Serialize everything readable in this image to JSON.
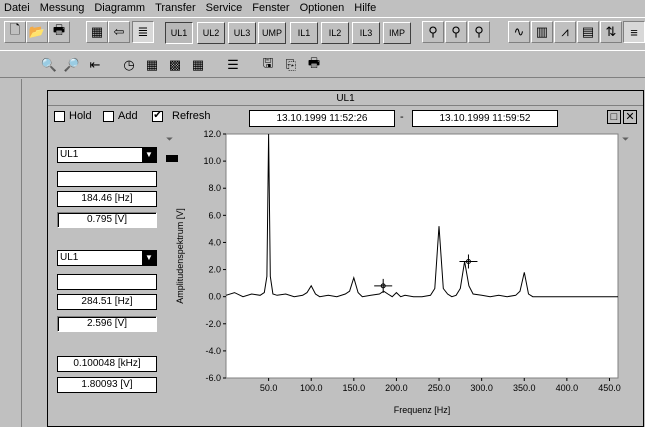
{
  "menu": [
    "Datei",
    "Messung",
    "Diagramm",
    "Transfer",
    "Service",
    "Fenster",
    "Optionen",
    "Hilfe"
  ],
  "channel_buttons": [
    "UL1",
    "UL2",
    "UL3",
    "UMP",
    "IL1",
    "IL2",
    "IL3",
    "IMP"
  ],
  "window": {
    "title": "UL1",
    "hold_label": "Hold",
    "add_label": "Add",
    "refresh_label": "Refresh",
    "refresh_checked": "✔",
    "date_from": "13.10.1999     11:52:26",
    "date_sep": "-",
    "date_to": "13.10.1999     11:59:52",
    "restore_label": "□",
    "close_label": "✕"
  },
  "cursor1": {
    "channel": "UL1",
    "name": "",
    "freq": "184.46 [Hz]",
    "value": "0.795 [V]"
  },
  "cursor2": {
    "channel": "UL1",
    "name": "",
    "freq": "284.51 [Hz]",
    "value": "2.596 [V]"
  },
  "delta": {
    "freq": "0.100048 [kHz]",
    "value": "1.80093 [V]"
  },
  "chart_data": {
    "type": "line",
    "xlabel": "Frequenz [Hz]",
    "ylabel": "Amplitudenspektrum [V]",
    "xlim": [
      0,
      460
    ],
    "ylim": [
      -6.0,
      12.0
    ],
    "x_ticks": [
      "50.0",
      "100.0",
      "150.0",
      "200.0",
      "250.0",
      "300.0",
      "350.0",
      "400.0",
      "450.0"
    ],
    "y_ticks": [
      "12.0",
      "10.0",
      "8.0",
      "6.0",
      "4.0",
      "2.0",
      "0.0",
      "-2.0",
      "-4.0",
      "-6.0"
    ],
    "series": [
      {
        "color": "#000000",
        "x": [
          0,
          10,
          20,
          30,
          40,
          45,
          48,
          50,
          52,
          55,
          60,
          70,
          80,
          90,
          95,
          100,
          105,
          110,
          120,
          130,
          140,
          145,
          150,
          155,
          160,
          170,
          180,
          185,
          190,
          195,
          200,
          205,
          210,
          220,
          230,
          240,
          245,
          250,
          255,
          260,
          265,
          270,
          275,
          280,
          285,
          290,
          300,
          310,
          320,
          330,
          340,
          345,
          350,
          355,
          360,
          380,
          400,
          420,
          440,
          460
        ],
        "y": [
          0.1,
          0.3,
          0.0,
          0.2,
          0.1,
          0.3,
          1.5,
          12.0,
          1.5,
          0.2,
          0.1,
          0.2,
          0.0,
          0.1,
          0.3,
          0.8,
          0.2,
          0.0,
          0.1,
          0.0,
          0.2,
          0.4,
          1.4,
          0.3,
          0.0,
          0.1,
          0.2,
          0.4,
          0.2,
          0.0,
          0.3,
          0.0,
          0.1,
          0.0,
          0.0,
          0.1,
          0.6,
          5.2,
          0.6,
          0.2,
          0.0,
          0.1,
          0.6,
          2.6,
          0.8,
          0.2,
          0.1,
          0.0,
          0.1,
          0.0,
          0.1,
          0.4,
          1.8,
          0.2,
          0.0,
          0.0,
          0.0,
          0.0,
          0.0,
          0.0
        ]
      }
    ],
    "cursors": [
      {
        "x": 184.46,
        "y": 0.795
      },
      {
        "x": 284.51,
        "y": 2.596
      }
    ]
  }
}
